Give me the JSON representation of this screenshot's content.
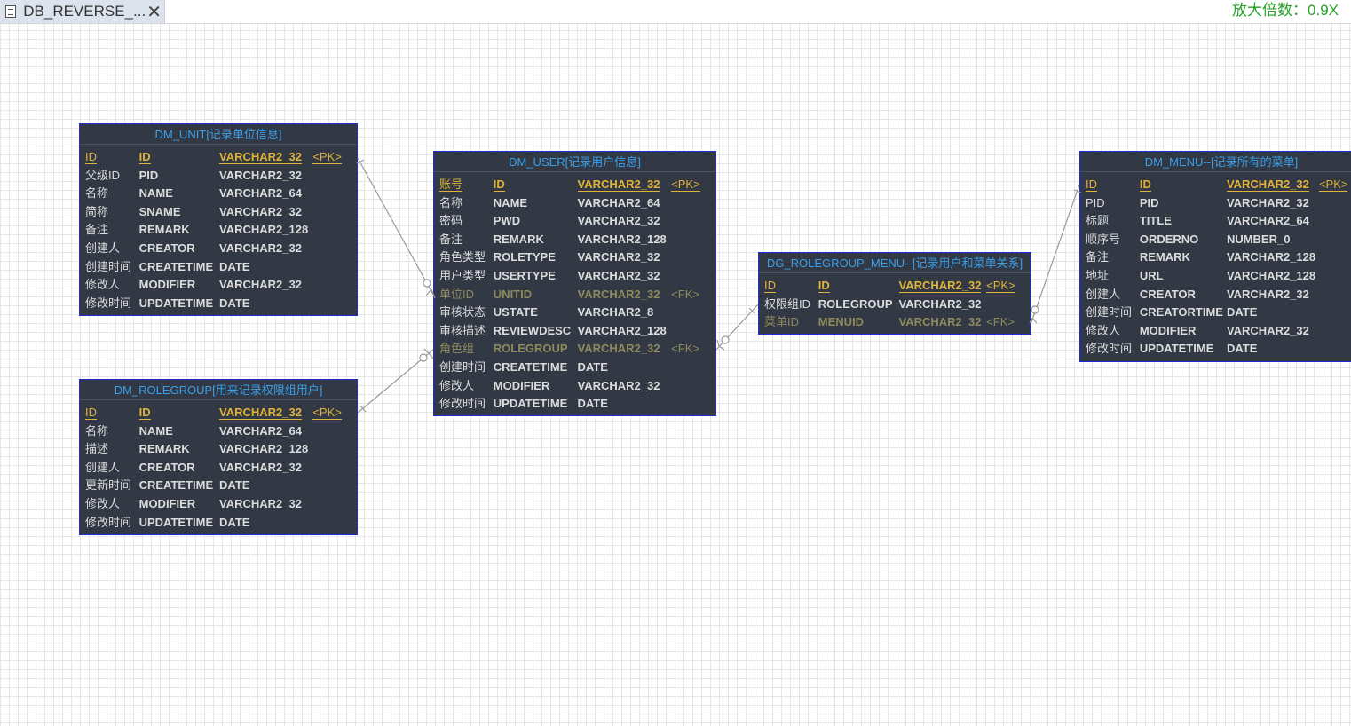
{
  "tab": {
    "title": "DB_REVERSE_...",
    "close_icon": "close-icon",
    "doc_icon": "document-icon"
  },
  "zoom_label": "放大倍数：0.9X",
  "entities": {
    "unit": {
      "title": "DM_UNIT[记录单位信息]",
      "rows": [
        {
          "name": "ID",
          "code": "ID",
          "type": "VARCHAR2_32",
          "key": "<PK>",
          "kind": "pk"
        },
        {
          "name": "父级ID",
          "code": "PID",
          "type": "VARCHAR2_32",
          "key": "",
          "kind": ""
        },
        {
          "name": "名称",
          "code": "NAME",
          "type": "VARCHAR2_64",
          "key": "",
          "kind": ""
        },
        {
          "name": "简称",
          "code": "SNAME",
          "type": "VARCHAR2_32",
          "key": "",
          "kind": ""
        },
        {
          "name": "备注",
          "code": "REMARK",
          "type": "VARCHAR2_128",
          "key": "",
          "kind": ""
        },
        {
          "name": "创建人",
          "code": "CREATOR",
          "type": "VARCHAR2_32",
          "key": "",
          "kind": ""
        },
        {
          "name": "创建时间",
          "code": "CREATETIME",
          "type": "DATE",
          "key": "",
          "kind": ""
        },
        {
          "name": "修改人",
          "code": "MODIFIER",
          "type": "VARCHAR2_32",
          "key": "",
          "kind": ""
        },
        {
          "name": "修改时间",
          "code": "UPDATETIME",
          "type": "DATE",
          "key": "",
          "kind": ""
        }
      ]
    },
    "rolegroup": {
      "title": "DM_ROLEGROUP[用来记录权限组用户]",
      "rows": [
        {
          "name": "ID",
          "code": "ID",
          "type": "VARCHAR2_32",
          "key": "<PK>",
          "kind": "pk"
        },
        {
          "name": "名称",
          "code": "NAME",
          "type": "VARCHAR2_64",
          "key": "",
          "kind": ""
        },
        {
          "name": "描述",
          "code": "REMARK",
          "type": "VARCHAR2_128",
          "key": "",
          "kind": ""
        },
        {
          "name": "创建人",
          "code": "CREATOR",
          "type": "VARCHAR2_32",
          "key": "",
          "kind": ""
        },
        {
          "name": "更新时间",
          "code": "CREATETIME",
          "type": "DATE",
          "key": "",
          "kind": ""
        },
        {
          "name": "修改人",
          "code": "MODIFIER",
          "type": "VARCHAR2_32",
          "key": "",
          "kind": ""
        },
        {
          "name": "修改时间",
          "code": "UPDATETIME",
          "type": "DATE",
          "key": "",
          "kind": ""
        }
      ]
    },
    "user": {
      "title": "DM_USER[记录用户信息]",
      "rows": [
        {
          "name": "账号",
          "code": "ID",
          "type": "VARCHAR2_32",
          "key": "<PK>",
          "kind": "pk"
        },
        {
          "name": "名称",
          "code": "NAME",
          "type": "VARCHAR2_64",
          "key": "",
          "kind": ""
        },
        {
          "name": "密码",
          "code": "PWD",
          "type": "VARCHAR2_32",
          "key": "",
          "kind": ""
        },
        {
          "name": "备注",
          "code": "REMARK",
          "type": "VARCHAR2_128",
          "key": "",
          "kind": ""
        },
        {
          "name": "角色类型",
          "code": "ROLETYPE",
          "type": "VARCHAR2_32",
          "key": "",
          "kind": ""
        },
        {
          "name": "用户类型",
          "code": "USERTYPE",
          "type": "VARCHAR2_32",
          "key": "",
          "kind": ""
        },
        {
          "name": "单位ID",
          "code": "UNITID",
          "type": "VARCHAR2_32",
          "key": "<FK>",
          "kind": "fk"
        },
        {
          "name": "审核状态",
          "code": "USTATE",
          "type": "VARCHAR2_8",
          "key": "",
          "kind": ""
        },
        {
          "name": "审核描述",
          "code": "REVIEWDESC",
          "type": "VARCHAR2_128",
          "key": "",
          "kind": ""
        },
        {
          "name": "角色组",
          "code": "ROLEGROUP",
          "type": "VARCHAR2_32",
          "key": "<FK>",
          "kind": "fk"
        },
        {
          "name": "创建时间",
          "code": "CREATETIME",
          "type": "DATE",
          "key": "",
          "kind": ""
        },
        {
          "name": "修改人",
          "code": "MODIFIER",
          "type": "VARCHAR2_32",
          "key": "",
          "kind": ""
        },
        {
          "name": "修改时间",
          "code": "UPDATETIME",
          "type": "DATE",
          "key": "",
          "kind": ""
        }
      ]
    },
    "rolegroup_menu": {
      "title": "DG_ROLEGROUP_MENU--[记录用户和菜单关系]",
      "rows": [
        {
          "name": "ID",
          "code": "ID",
          "type": "VARCHAR2_32",
          "key": "<PK>",
          "kind": "pk"
        },
        {
          "name": "权限组ID",
          "code": "ROLEGROUP",
          "type": "VARCHAR2_32",
          "key": "",
          "kind": ""
        },
        {
          "name": "菜单ID",
          "code": "MENUID",
          "type": "VARCHAR2_32",
          "key": "<FK>",
          "kind": "fk"
        }
      ]
    },
    "menu": {
      "title": "DM_MENU--[记录所有的菜单]",
      "rows": [
        {
          "name": "ID",
          "code": "ID",
          "type": "VARCHAR2_32",
          "key": "<PK>",
          "kind": "pk"
        },
        {
          "name": "PID",
          "code": "PID",
          "type": "VARCHAR2_32",
          "key": "",
          "kind": ""
        },
        {
          "name": "标题",
          "code": "TITLE",
          "type": "VARCHAR2_64",
          "key": "",
          "kind": ""
        },
        {
          "name": "顺序号",
          "code": "ORDERNO",
          "type": "NUMBER_0",
          "key": "",
          "kind": ""
        },
        {
          "name": "备注",
          "code": "REMARK",
          "type": "VARCHAR2_128",
          "key": "",
          "kind": ""
        },
        {
          "name": "地址",
          "code": "URL",
          "type": "VARCHAR2_128",
          "key": "",
          "kind": ""
        },
        {
          "name": "创建人",
          "code": "CREATOR",
          "type": "VARCHAR2_32",
          "key": "",
          "kind": ""
        },
        {
          "name": "创建时间",
          "code": "CREATORTIME",
          "type": "DATE",
          "key": "",
          "kind": ""
        },
        {
          "name": "修改人",
          "code": "MODIFIER",
          "type": "VARCHAR2_32",
          "key": "",
          "kind": ""
        },
        {
          "name": "修改时间",
          "code": "UPDATETIME",
          "type": "DATE",
          "key": "",
          "kind": ""
        }
      ]
    }
  },
  "colors": {
    "entity_bg": "#323844",
    "entity_border": "#1e2bd6",
    "title_text": "#3aa0ea",
    "pk_text": "#e0b43a",
    "fk_text": "#8e8a5e",
    "link_line": "#9a9a9a",
    "zoom_text": "#2aa02a"
  }
}
